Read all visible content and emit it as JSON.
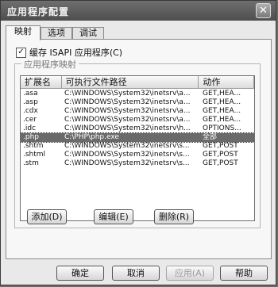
{
  "window": {
    "title": "应用程序配置",
    "close_glyph": "✕"
  },
  "tabs": [
    {
      "label": "映射",
      "active": true
    },
    {
      "label": "选项",
      "active": false
    },
    {
      "label": "调试",
      "active": false
    }
  ],
  "cache_checkbox": {
    "label": "缓存 ISAPI 应用程序(C)",
    "checked": true,
    "mark": "✓"
  },
  "mappings": {
    "group_label": "应用程序映射",
    "columns": [
      "扩展名",
      "可执行文件路径",
      "动作"
    ],
    "rows": [
      {
        "ext": ".asa",
        "path": "C:\\WINDOWS\\System32\\inetsrv\\a...",
        "verbs": "GET,HEA..."
      },
      {
        "ext": ".asp",
        "path": "C:\\WINDOWS\\System32\\inetsrv\\a...",
        "verbs": "GET,HEA..."
      },
      {
        "ext": ".cdx",
        "path": "C:\\WINDOWS\\System32\\inetsrv\\a...",
        "verbs": "GET,HEA..."
      },
      {
        "ext": ".cer",
        "path": "C:\\WINDOWS\\System32\\inetsrv\\a...",
        "verbs": "GET,HEA..."
      },
      {
        "ext": ".idc",
        "path": "C:\\WINDOWS\\System32\\inetsrv\\h...",
        "verbs": "OPTIONS..."
      },
      {
        "ext": ".php",
        "path": "C:\\PHP\\php.exe",
        "verbs": "全部",
        "selected": true
      },
      {
        "ext": ".shtm",
        "path": "C:\\WINDOWS\\System32\\inetsrv\\s...",
        "verbs": "GET,POST"
      },
      {
        "ext": ".shtml",
        "path": "C:\\WINDOWS\\System32\\inetsrv\\s...",
        "verbs": "GET,POST"
      },
      {
        "ext": ".stm",
        "path": "C:\\WINDOWS\\System32\\inetsrv\\s...",
        "verbs": "GET,POST"
      }
    ]
  },
  "actions": {
    "add": "添加(D)",
    "edit": "编辑(E)",
    "remove": "删除(R)"
  },
  "footer": {
    "ok": "确定",
    "cancel": "取消",
    "apply": "应用(A)",
    "help": "帮助"
  }
}
